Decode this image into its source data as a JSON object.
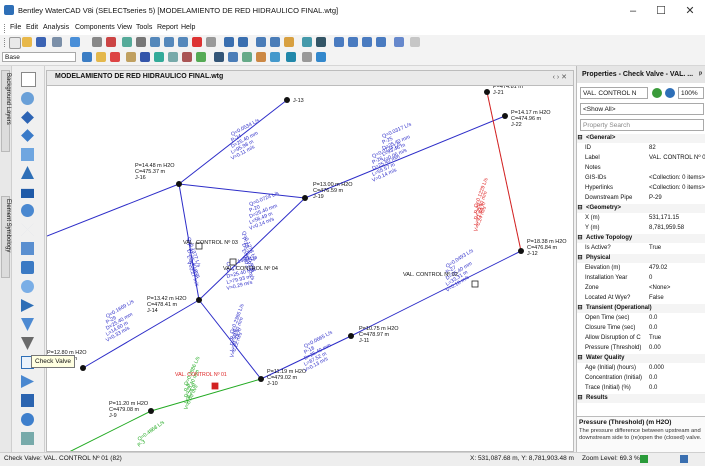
{
  "window": {
    "title": "Bentley WaterCAD V8i (SELECTseries 5) [MODELAMIENTO DE RED HIDRAULICO FINAL.wtg]",
    "minimize": "–",
    "maximize": "☐",
    "close": "✕"
  },
  "menu": [
    "File",
    "Edit",
    "Analysis",
    "Components",
    "View",
    "Tools",
    "Report",
    "Help"
  ],
  "toolbar": {
    "scenario_combo": "Base"
  },
  "left_tabs": [
    "Background Layers",
    "Element Symbology"
  ],
  "drawing": {
    "tab_title": "MODELAMIENTO DE RED HIDRAULICO FINAL.wtg",
    "nav_arrows": "‹ › ✕",
    "junctions": [
      {
        "id": "J-13",
        "p": "",
        "c": ""
      },
      {
        "id": "J-21",
        "p": "P=474.81 m",
        "c": ""
      },
      {
        "id": "J-22",
        "p": "P=14.17 m H2O",
        "c": "C=474.96 m"
      },
      {
        "id": "J-16",
        "p": "P=14.48 m H2O",
        "c": "C=475.37 m"
      },
      {
        "id": "J-19",
        "p": "P=13.00 m H2O",
        "c": "C=476.59 m"
      },
      {
        "id": "J-12",
        "p": "P=18.38 m H2O",
        "c": "C=476.84 m"
      },
      {
        "id": "J-14",
        "p": "P=13.42 m H2O",
        "c": "C=478.41 m"
      },
      {
        "id": "J-15",
        "p": "P=12.80 m H2O",
        "c": "C=478.69 m"
      },
      {
        "id": "J-11",
        "p": "P=10.75 m H2O",
        "c": "C=478.97 m"
      },
      {
        "id": "J-10",
        "p": "P=11.19 m H2O",
        "c": "C=479.02 m"
      },
      {
        "id": "J-9",
        "p": "P=11.20 m H2O",
        "c": "C=479.08 m"
      }
    ],
    "pipes": [
      {
        "id": "P-24",
        "q": "Q=0.0534 L/s",
        "d": "D=25.40 mm",
        "l": "L=95.98 m",
        "v": "V=0.11 m/s"
      },
      {
        "id": "P-26",
        "q": "Q=0.0724 L/s",
        "d": "D=25.40 mm",
        "l": "L=55.57 m",
        "v": "V=0.14 m/s"
      },
      {
        "id": "P-25",
        "q": "Q=0.0317 L/s",
        "d": "D=25.40 mm",
        "l": "L=93.46 m",
        "v": "V=0.06 m/s"
      },
      {
        "id": "P-22",
        "q": "Q=0.1229 L/s",
        "d": "D=25.40 mm",
        "l": "L=71.44 m",
        "v": "V=0.24 m/s"
      },
      {
        "id": "P-20",
        "q": "Q=0.0724 L/s",
        "d": "D=25.40 mm",
        "l": "L=56.49 m",
        "v": "V=0.14 m/s"
      },
      {
        "id": "P-19",
        "q": "Q=0.1278 L/s",
        "d": "D=25.40 mm",
        "l": "L=83.97 m",
        "v": "V=0.25 m/s"
      },
      {
        "id": "P-21",
        "q": "Q=0.1377 L/s",
        "d": "D=25.40 mm",
        "l": "L=45.40 m",
        "v": "V=0.27 m/s"
      },
      {
        "id": "P-17",
        "q": "Q=0.1480 L/s",
        "d": "D=25.40 mm",
        "l": "L=79.93 m",
        "v": "V=0.29 m/s"
      },
      {
        "id": "P-27",
        "q": "Q=0.0493 L/s",
        "d": "D=25.40 mm",
        "l": "L=33.31 m",
        "v": "V=0.10 m/s"
      },
      {
        "id": "P-29",
        "q": "Q=0.1669 L/s",
        "d": "D=25.40 mm",
        "l": "L=14.60 m",
        "v": "V=0.33 m/s"
      },
      {
        "id": "P-18",
        "q": "Q=0.0665 L/s",
        "d": "D=25.40 mm",
        "l": "L=87.52 m",
        "v": "V=0.13 m/s"
      },
      {
        "id": "P-14",
        "q": "Q=0.2386 L/s",
        "d": "D=50.80 mm",
        "l": "L=31.79 m",
        "v": "V=0.12 m/s"
      },
      {
        "id": "P-5",
        "q": "Q=0.2886 L/s",
        "d": "D=25.40 mm",
        "l": "L=8.24 m",
        "v": "V=0.09 m/s"
      },
      {
        "id": "P-3",
        "q": "Q=0.4868 L/s",
        "d": "",
        "l": "",
        "v": ""
      }
    ],
    "valves": [
      "VAL. CONTROL Nº 03",
      "VAL. CONTROL Nº 04",
      "VAL. CONTROL Nº 02",
      "VAL. CONTROL Nº 01"
    ]
  },
  "properties": {
    "panel_title": "Properties - Check Valve - VAL. ...",
    "pin_glyph": "ᵖ",
    "element_combo": "VAL. CONTROL N",
    "zoom_combo": "100%",
    "show_combo": "<Show All>",
    "search_placeholder": "Property Search",
    "rows": [
      {
        "k": "<General>",
        "v": "",
        "cat": true
      },
      {
        "k": "ID",
        "v": "82"
      },
      {
        "k": "Label",
        "v": "VAL. CONTROL Nº 01"
      },
      {
        "k": "Notes",
        "v": ""
      },
      {
        "k": "GIS-IDs",
        "v": "<Collection: 0 items>"
      },
      {
        "k": "Hyperlinks",
        "v": "<Collection: 0 items>"
      },
      {
        "k": "Downstream Pipe",
        "v": "P-29"
      },
      {
        "k": "<Geometry>",
        "v": "",
        "cat": true
      },
      {
        "k": "X (m)",
        "v": "531,171.15"
      },
      {
        "k": "Y (m)",
        "v": "8,781,959.58"
      },
      {
        "k": "Active Topology",
        "v": "",
        "cat": true
      },
      {
        "k": "Is Active?",
        "v": "True"
      },
      {
        "k": "Physical",
        "v": "",
        "cat": true
      },
      {
        "k": "Elevation (m)",
        "v": "479.02"
      },
      {
        "k": "Installation Year",
        "v": "0"
      },
      {
        "k": "Zone",
        "v": "<None>"
      },
      {
        "k": "Located At Wye?",
        "v": "False"
      },
      {
        "k": "Transient (Operational)",
        "v": "",
        "cat": true
      },
      {
        "k": "Open Time (sec)",
        "v": "0.0"
      },
      {
        "k": "Closure Time (sec)",
        "v": "0.0"
      },
      {
        "k": "Allow Disruption of C",
        "v": "True"
      },
      {
        "k": "Pressure (Threshold)",
        "v": "0.00"
      },
      {
        "k": "Water Quality",
        "v": "",
        "cat": true
      },
      {
        "k": "Age (Initial) (hours)",
        "v": "0.000"
      },
      {
        "k": "Concentration (Initial)",
        "v": "0.0"
      },
      {
        "k": "Trace (Initial) (%)",
        "v": "0.0"
      },
      {
        "k": "Results",
        "v": "",
        "cat": true
      }
    ],
    "desc_title": "Pressure (Threshold) (m H2O)",
    "desc_text": "The pressure difference between upstream and downstream side to (re)open the (closed) valve."
  },
  "tooltip": "Check Valve",
  "status": {
    "left": "Check Valve: VAL. CONTROL Nº 01 (82)",
    "coords": "X: 531,087.68 m, Y: 8,781,903.48 m",
    "zoom": "Zoom Level: 69.3 %"
  },
  "colors": {
    "pipe_blue": "#2d2dc8",
    "pipe_red": "#d22222",
    "pipe_green": "#22aa22",
    "accent": "#2e6fb7"
  }
}
